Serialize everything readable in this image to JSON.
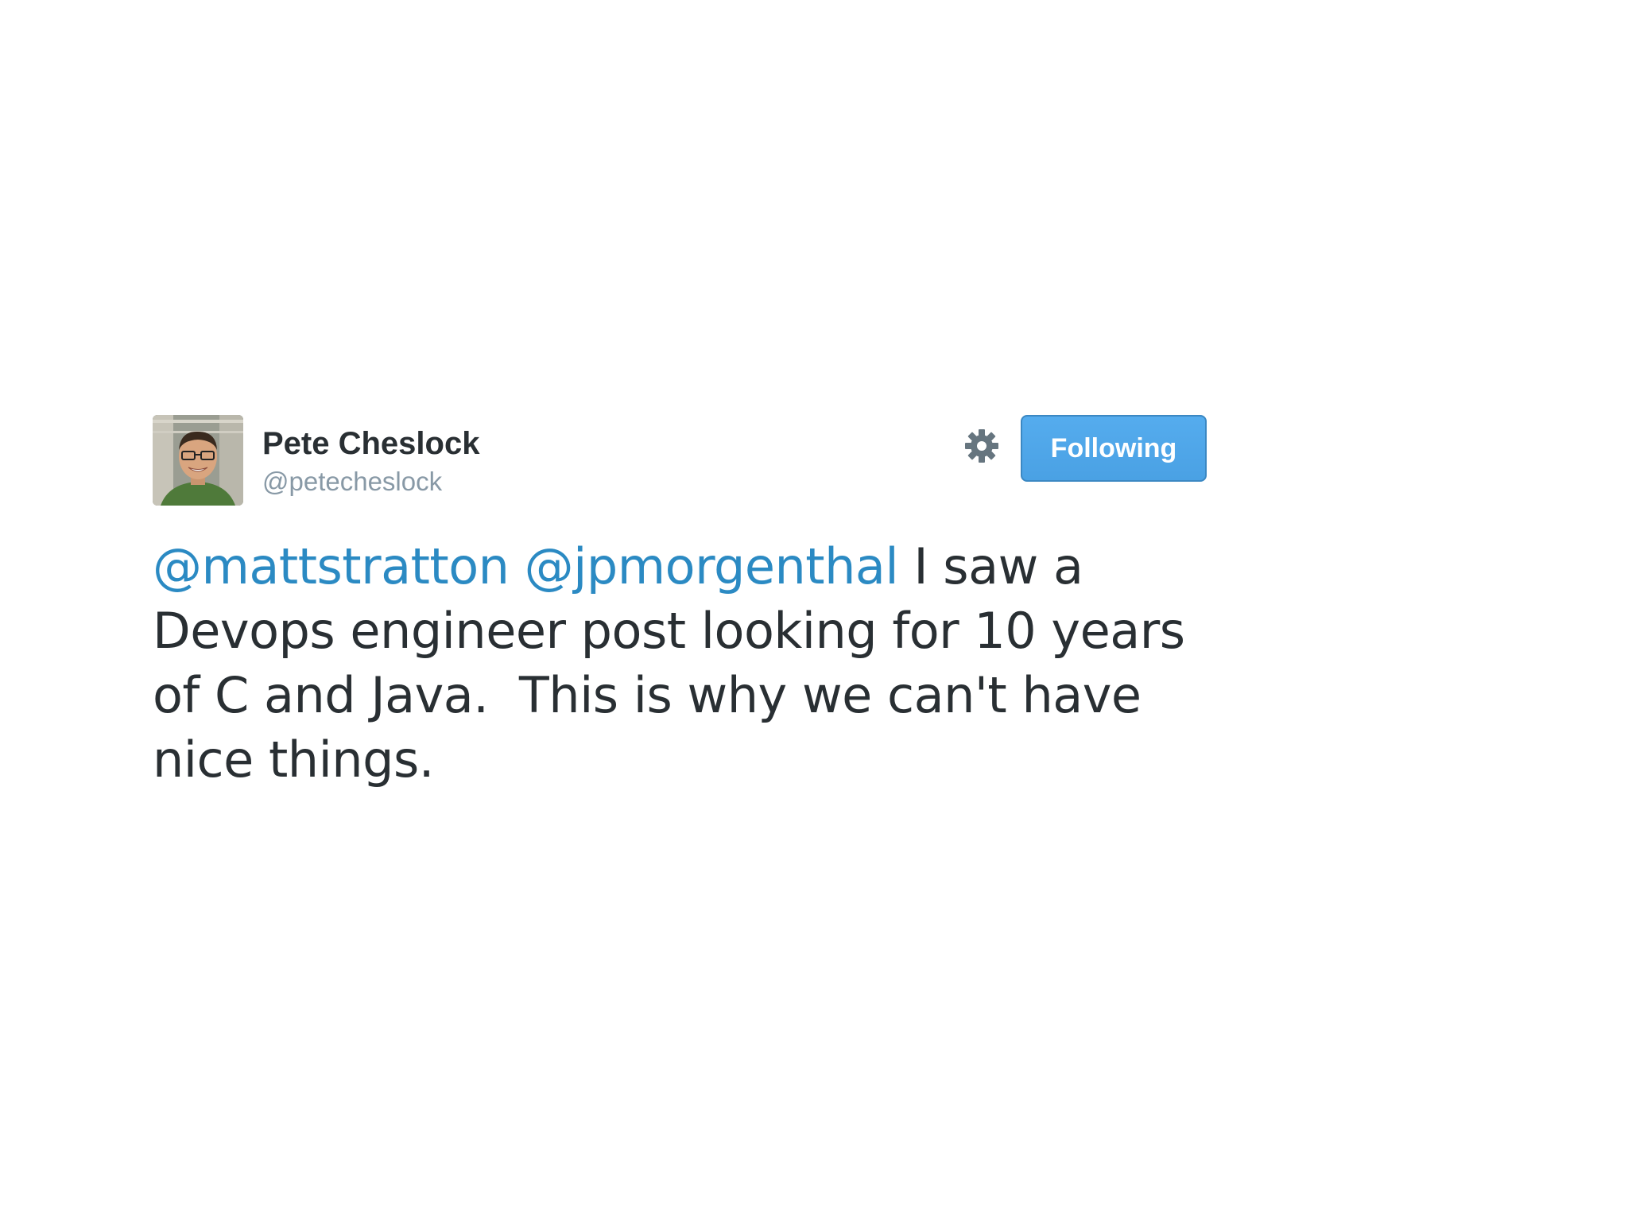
{
  "tweet": {
    "author_name": "Pete Cheslock",
    "author_handle": "@petecheslock",
    "follow_button_label": "Following",
    "text_segments": {
      "mention_1": "@mattstratton",
      "mention_2": "@jpmorgenthal",
      "line_1_rest": " I saw a",
      "line_2": "Devops engineer post looking for 10 years",
      "line_3": "of C and Java.  This is why we can't have",
      "line_4": "nice things."
    }
  },
  "icons": {
    "gear": "gear-icon",
    "avatar": "avatar"
  },
  "colors": {
    "mention": "#2b8ac3",
    "button": "#55acee",
    "text": "#292f33",
    "handle": "#8899a6"
  }
}
